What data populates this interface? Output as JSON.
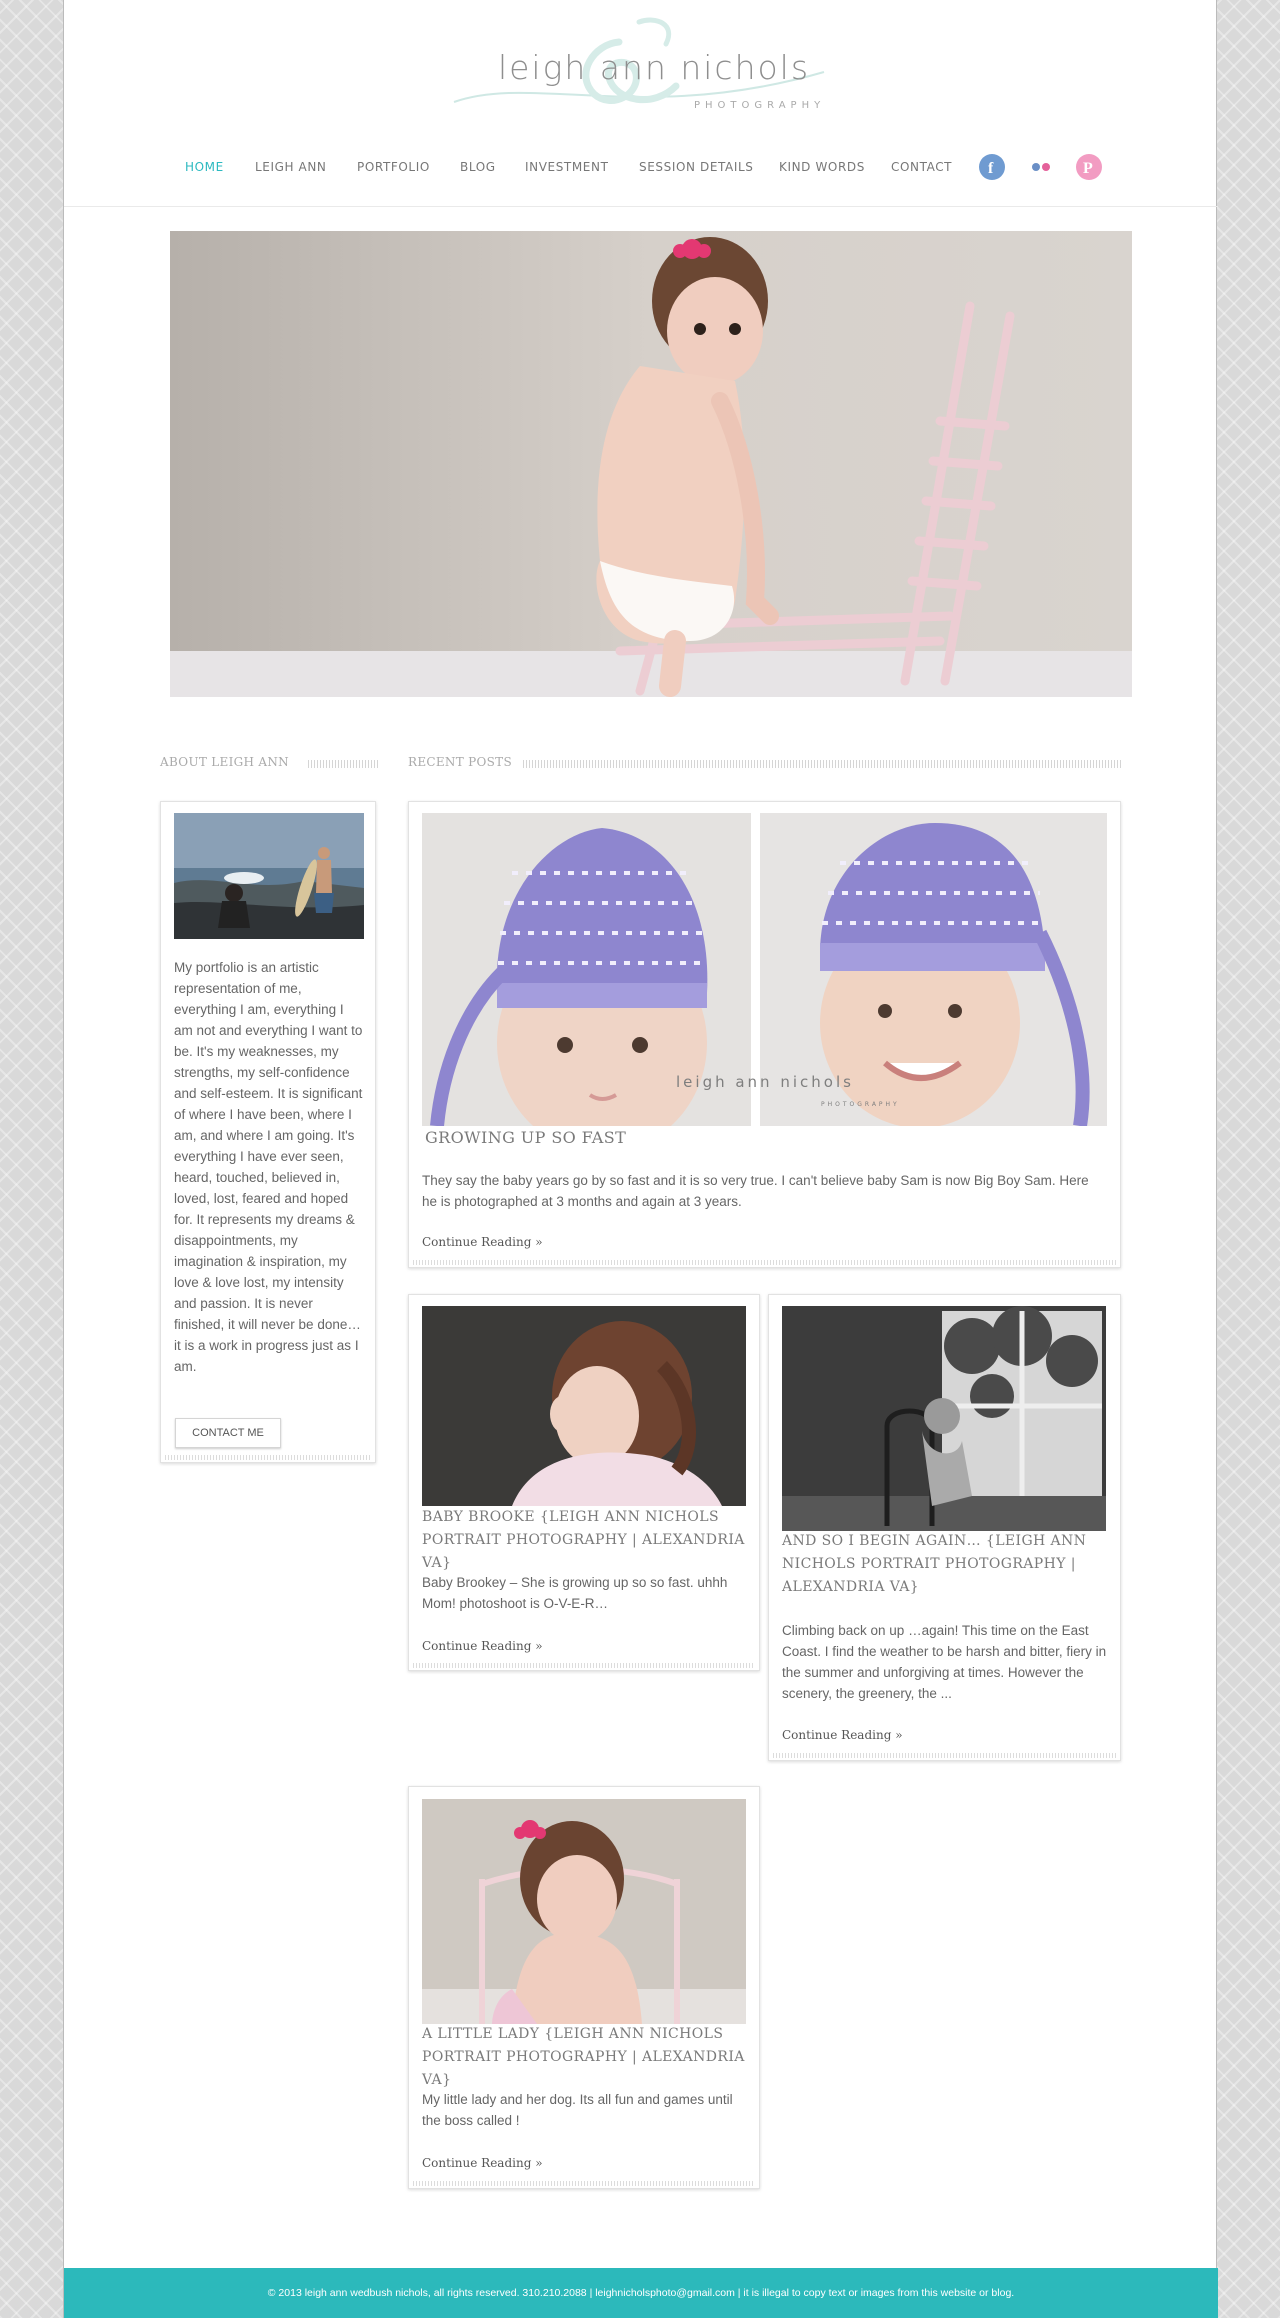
{
  "brand": {
    "name": "leigh ann nichols",
    "tagline": "PHOTOGRAPHY",
    "accent": "#2cb9c0"
  },
  "nav": {
    "items": [
      "HOME",
      "LEIGH ANN",
      "PORTFOLIO",
      "BLOG",
      "INVESTMENT",
      "SESSION DETAILS",
      "KIND WORDS",
      "CONTACT"
    ],
    "active": "HOME",
    "social": [
      "facebook-icon",
      "flickr-icon",
      "pinterest-icon"
    ]
  },
  "sidebar": {
    "title": "ABOUT LEIGH ANN",
    "about": "My portfolio is an artistic representation of me, everything I am, everything I am not and everything I want to be. It's my weaknesses, my strengths, my self-confidence and self-esteem. It is significant of where I have been, where I am, and where I am going. It's everything I have ever seen, heard, touched, believed in, loved, lost, feared and hoped for. It represents my dreams & disappointments, my imagination & inspiration, my love & love lost, my intensity and passion. It is never finished, it will never be done…it is a work in progress just as I am.",
    "contact_label": "CONTACT ME"
  },
  "recent": {
    "title": "RECENT POSTS",
    "continue_label": "Continue Reading »",
    "watermark": "leigh ann nichols",
    "watermark_sub": "PHOTOGRAPHY",
    "posts": [
      {
        "title": "GROWING UP SO FAST",
        "excerpt": "They say the baby years go by so fast and it is so very true. I can't believe baby Sam is now Big Boy Sam. Here he is photographed at 3 months and again at 3 years."
      },
      {
        "title": "BABY BROOKE {LEIGH ANN NICHOLS PORTRAIT PHOTOGRAPHY | ALEXANDRIA VA}",
        "excerpt": "Baby Brookey – She is growing up so so fast.  uhhh Mom!  photoshoot is O-V-E-R…"
      },
      {
        "title": "AND SO I BEGIN AGAIN… {LEIGH ANN NICHOLS PORTRAIT PHOTOGRAPHY | ALEXANDRIA VA}",
        "excerpt": "Climbing back on up …again! This time on the East Coast. I find the weather to be harsh and bitter, fiery in the summer and unforgiving at times. However the scenery, the greenery, the ..."
      },
      {
        "title": "A LITTLE LADY {LEIGH ANN NICHOLS PORTRAIT PHOTOGRAPHY | ALEXANDRIA VA}",
        "excerpt": "My little lady and her dog. Its all fun and games until the boss called !"
      }
    ]
  },
  "footer": {
    "text": "© 2013 leigh ann wedbush nichols, all rights reserved. 310.210.2088 | leighnicholsphoto@gmail.com | it is illegal to copy text or images from this website or blog."
  }
}
